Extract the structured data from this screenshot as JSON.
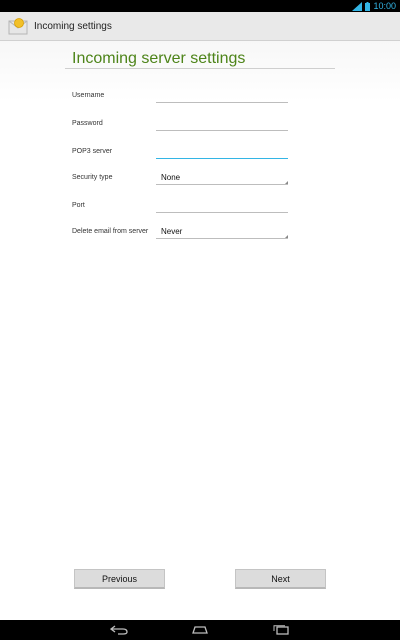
{
  "status_bar": {
    "time": "10:00"
  },
  "action_bar": {
    "title": "Incoming settings",
    "icon": "email-envelope-icon"
  },
  "page": {
    "heading": "Incoming server settings"
  },
  "form": {
    "username": {
      "label": "Username",
      "value": ""
    },
    "password": {
      "label": "Password",
      "value": ""
    },
    "pop3_server": {
      "label": "POP3 server",
      "value": ""
    },
    "security_type": {
      "label": "Security type",
      "value": "None"
    },
    "port": {
      "label": "Port",
      "value": ""
    },
    "delete_email": {
      "label": "Delete email from server",
      "value": "Never"
    }
  },
  "buttons": {
    "previous": "Previous",
    "next": "Next"
  },
  "colors": {
    "heading": "#4d8419",
    "accent": "#33b5e5",
    "status_bar": "#000000"
  },
  "nav_bar": {
    "icons": [
      "back-icon",
      "home-icon",
      "recent-apps-icon"
    ]
  }
}
